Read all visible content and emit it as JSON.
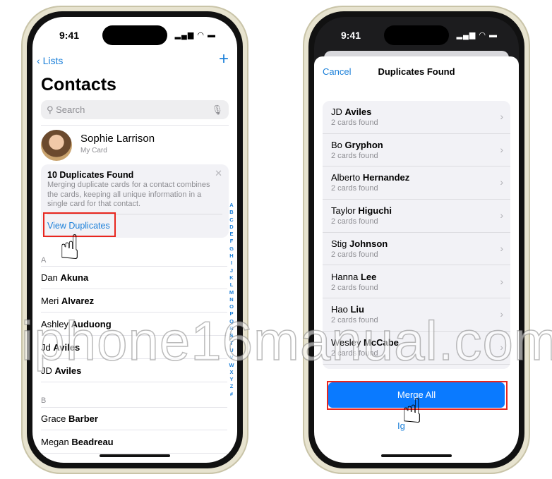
{
  "left_phone": {
    "status_time": "9:41",
    "nav_back": "Lists",
    "nav_add": "+",
    "title": "Contacts",
    "search_placeholder": "Search",
    "my_card": {
      "name": "Sophie Larrison",
      "subtitle": "My Card"
    },
    "duplicates_banner": {
      "title": "10 Duplicates Found",
      "body": "Merging duplicate cards for a contact combines the cards, keeping all unique information in a single card for that contact.",
      "action": "View Duplicates"
    },
    "sections": [
      {
        "letter": "A",
        "contacts": [
          {
            "first": "Dan",
            "last": "Akuna"
          },
          {
            "first": "Meri",
            "last": "Alvarez"
          },
          {
            "first": "Ashley",
            "last": "Auduong"
          },
          {
            "first": "Jd",
            "last": "Aviles"
          },
          {
            "first": "JD",
            "last": "Aviles"
          }
        ]
      },
      {
        "letter": "B",
        "contacts": [
          {
            "first": "Grace",
            "last": "Barber"
          },
          {
            "first": "Megan",
            "last": "Beadreau"
          }
        ]
      }
    ],
    "index_letters": [
      "A",
      "B",
      "C",
      "D",
      "E",
      "F",
      "G",
      "H",
      "I",
      "J",
      "K",
      "L",
      "M",
      "N",
      "O",
      "P",
      "Q",
      "R",
      "S",
      "T",
      "U",
      "V",
      "W",
      "X",
      "Y",
      "Z",
      "#"
    ]
  },
  "right_phone": {
    "status_time": "9:41",
    "cancel": "Cancel",
    "title": "Duplicates Found",
    "duplicates": [
      {
        "first": "JD",
        "last": "Aviles",
        "count": "2 cards found"
      },
      {
        "first": "Bo",
        "last": "Gryphon",
        "count": "2 cards found"
      },
      {
        "first": "Alberto",
        "last": "Hernandez",
        "count": "2 cards found"
      },
      {
        "first": "Taylor",
        "last": "Higuchi",
        "count": "2 cards found"
      },
      {
        "first": "Stig",
        "last": "Johnson",
        "count": "2 cards found"
      },
      {
        "first": "Hanna",
        "last": "Lee",
        "count": "2 cards found"
      },
      {
        "first": "Hao",
        "last": "Liu",
        "count": "2 cards found"
      },
      {
        "first": "Wesley",
        "last": "McCabe",
        "count": "2 cards found"
      }
    ],
    "merge_all": "Merge All",
    "ignore_partial": "Ig"
  },
  "watermark": "iphone16manual.com",
  "colors": {
    "accent": "#1a7fd9",
    "merge_button": "#0a7aff",
    "highlight": "#e8261e"
  }
}
